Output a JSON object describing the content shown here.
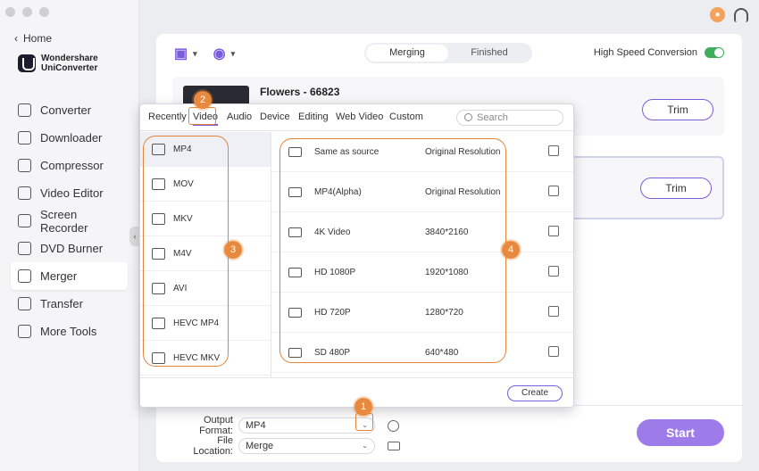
{
  "sidebar": {
    "home_label": "Home",
    "brand_line1": "Wondershare",
    "brand_line2": "UniConverter",
    "items": [
      {
        "label": "Converter"
      },
      {
        "label": "Downloader"
      },
      {
        "label": "Compressor"
      },
      {
        "label": "Video Editor"
      },
      {
        "label": "Screen Recorder"
      },
      {
        "label": "DVD Burner"
      },
      {
        "label": "Merger"
      },
      {
        "label": "Transfer"
      },
      {
        "label": "More Tools"
      }
    ]
  },
  "main": {
    "segment": {
      "merging": "Merging",
      "finished": "Finished"
    },
    "high_speed_label": "High Speed Conversion",
    "high_speed_on": true,
    "cards": [
      {
        "title": "Flowers - 66823",
        "trim_label": "Trim"
      },
      {
        "title": "",
        "trim_label": "Trim"
      }
    ],
    "output_format_label": "Output Format:",
    "output_format_value": "MP4",
    "file_location_label": "File Location:",
    "file_location_value": "Merge",
    "start_label": "Start"
  },
  "popup": {
    "tabs": [
      "Recently",
      "Video",
      "Audio",
      "Device",
      "Editing",
      "Web Video",
      "Custom"
    ],
    "search_placeholder": "Search",
    "formats": [
      "MP4",
      "MOV",
      "MKV",
      "M4V",
      "AVI",
      "HEVC MP4",
      "HEVC MKV"
    ],
    "resolutions": [
      {
        "name": "Same as source",
        "value": "Original Resolution"
      },
      {
        "name": "MP4(Alpha)",
        "value": "Original Resolution"
      },
      {
        "name": "4K Video",
        "value": "3840*2160"
      },
      {
        "name": "HD 1080P",
        "value": "1920*1080"
      },
      {
        "name": "HD 720P",
        "value": "1280*720"
      },
      {
        "name": "SD 480P",
        "value": "640*480"
      }
    ],
    "create_label": "Create"
  },
  "annotations": [
    "1",
    "2",
    "3",
    "4"
  ],
  "colors": {
    "accent": "#7b5cdc",
    "annotation": "#e8893d",
    "start": "#9d7cea",
    "toggle": "#3fae5c"
  }
}
